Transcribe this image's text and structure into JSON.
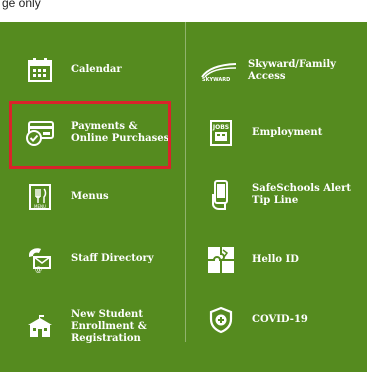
{
  "top_text": "ge only",
  "left_column": [
    {
      "label": "Calendar",
      "icon": "calendar-icon"
    },
    {
      "label": "Payments &\nOnline Purchases",
      "icon": "payment-card-icon"
    },
    {
      "label": "Menus",
      "icon": "menu-icon"
    },
    {
      "label": "Staff Directory",
      "icon": "phone-mail-icon"
    },
    {
      "label": "New Student\nEnrollment &\nRegistration",
      "icon": "school-building-icon"
    }
  ],
  "right_column": [
    {
      "label": "Skyward/Family\nAccess",
      "icon": "skyward-logo-icon"
    },
    {
      "label": "Employment",
      "icon": "jobs-icon"
    },
    {
      "label": "SafeSchools Alert\nTip Line",
      "icon": "phone-hand-icon"
    },
    {
      "label": "Hello ID",
      "icon": "puzzle-icon"
    },
    {
      "label": "COVID-19",
      "icon": "shield-plus-icon"
    }
  ],
  "colors": {
    "panel": "#558b1f",
    "highlight": "#d9232b"
  }
}
